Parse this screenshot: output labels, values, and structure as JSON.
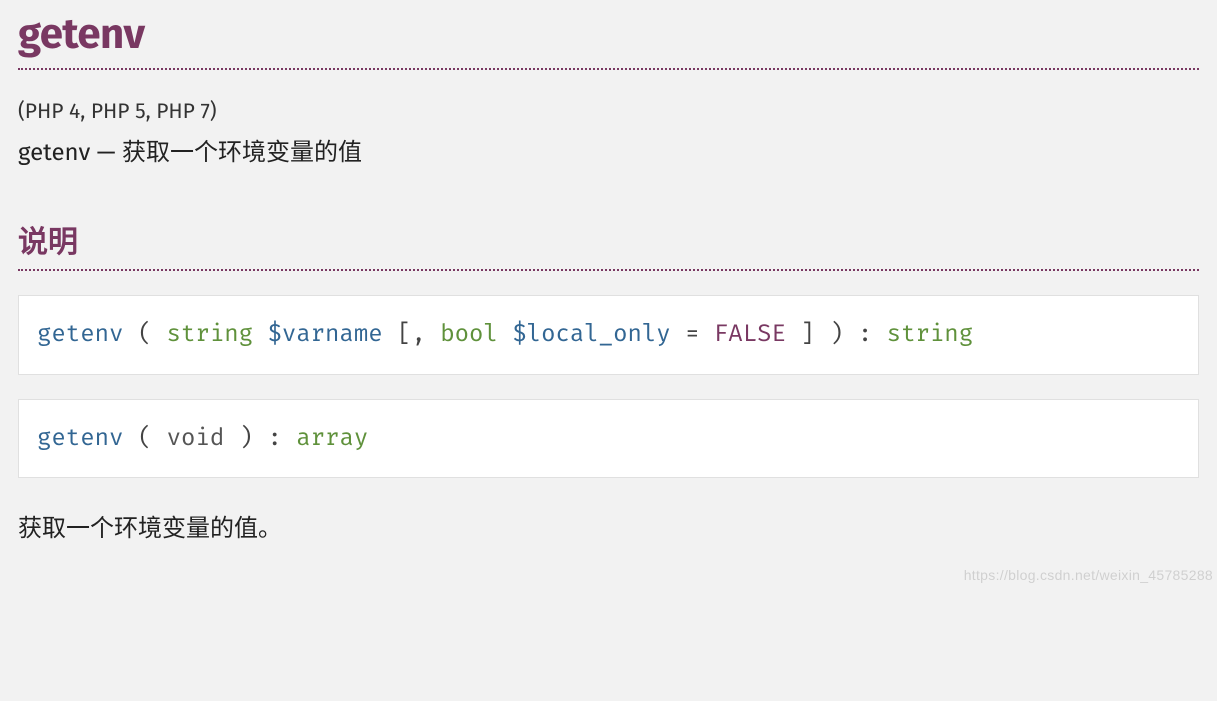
{
  "title": "getenv",
  "versions": "(PHP 4, PHP 5, PHP 7)",
  "summary": "getenv — 获取一个环境变量的值",
  "section_heading": "说明",
  "sig1": {
    "func": "getenv",
    "p1_type": "string",
    "p1_name": "$varname",
    "p2_type": "bool",
    "p2_name": "$local_only",
    "p2_default": "FALSE",
    "ret": "string"
  },
  "sig2": {
    "func": "getenv",
    "void": "void",
    "ret": "array"
  },
  "description": "获取一个环境变量的值。",
  "watermark": "https://blog.csdn.net/weixin_45785288"
}
